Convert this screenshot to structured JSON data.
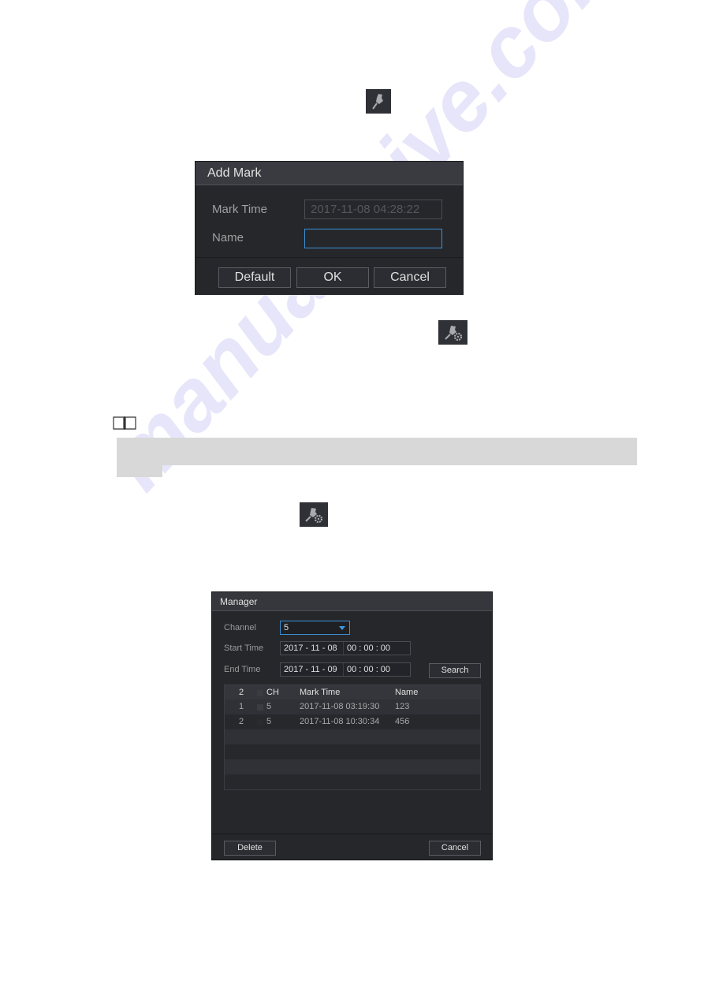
{
  "icons": {
    "add_mark_icon": "pushpin-icon",
    "mark_manager_icon": "pushpin-gear-icon",
    "note_icon": "open-book-icon"
  },
  "add_mark_dialog": {
    "title": "Add Mark",
    "mark_time_label": "Mark Time",
    "mark_time_value": "2017-11-08 04:28:22",
    "name_label": "Name",
    "name_value": "",
    "buttons": {
      "default": "Default",
      "ok": "OK",
      "cancel": "Cancel"
    }
  },
  "manager_dialog": {
    "title": "Manager",
    "channel_label": "Channel",
    "channel_value": "5",
    "start_time_label": "Start Time",
    "start_date": "2017 - 11 - 08",
    "start_time": "00 : 00 : 00",
    "end_time_label": "End Time",
    "end_date": "2017 - 11 - 09",
    "end_time": "00 : 00 : 00",
    "search_button": "Search",
    "table": {
      "headers": {
        "count": "2",
        "ch": "CH",
        "mark_time": "Mark Time",
        "name": "Name"
      },
      "rows": [
        {
          "num": "1",
          "ch": "5",
          "mark_time": "2017-11-08 03:19:30",
          "name": "123"
        },
        {
          "num": "2",
          "ch": "5",
          "mark_time": "2017-11-08 10:30:34",
          "name": "456"
        }
      ]
    },
    "delete_button": "Delete",
    "cancel_button": "Cancel"
  },
  "watermark": "manualshive.com",
  "colors": {
    "dialog_bg": "#26272b",
    "title_bg": "#3a3b40",
    "focus_border": "#3a8fd4",
    "note_shade": "#d8d8d8"
  }
}
